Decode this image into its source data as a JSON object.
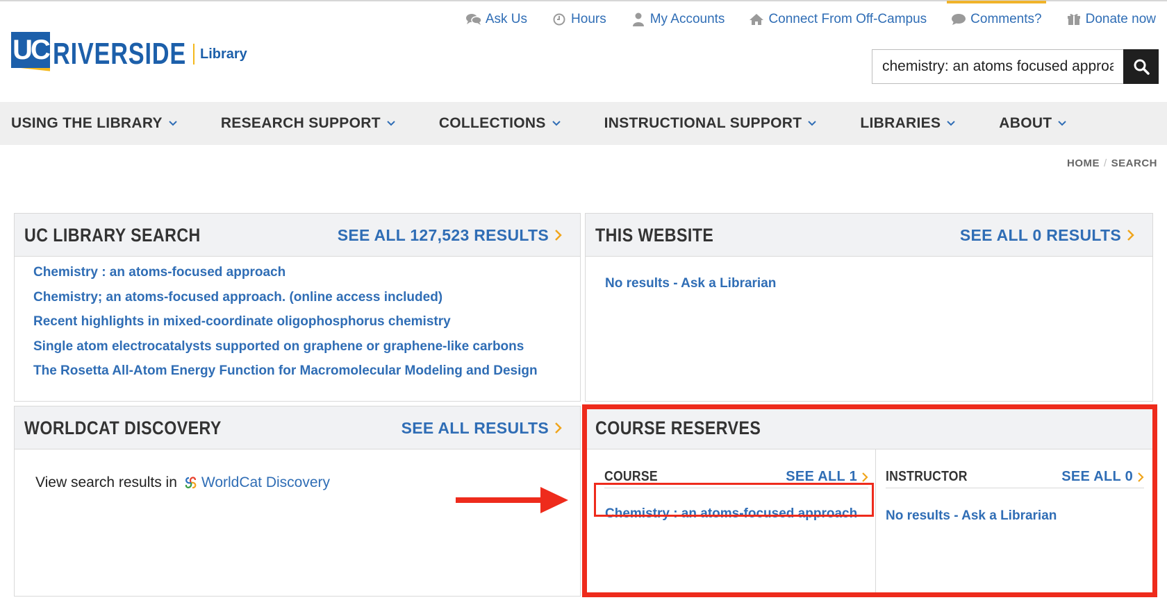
{
  "utility_nav": [
    {
      "label": "Ask Us",
      "icon": "chat-icon"
    },
    {
      "label": "Hours",
      "icon": "clock-icon"
    },
    {
      "label": "My Accounts",
      "icon": "user-icon"
    },
    {
      "label": "Connect From Off-Campus",
      "icon": "home-icon"
    },
    {
      "label": "Comments?",
      "icon": "comment-icon",
      "active": true
    },
    {
      "label": "Donate now",
      "icon": "gift-icon"
    }
  ],
  "logo": {
    "uc": "UC",
    "name": "RIVERSIDE",
    "sub": "Library"
  },
  "search": {
    "value": "chemistry: an atoms focused approa"
  },
  "main_nav": [
    {
      "label": "USING THE LIBRARY"
    },
    {
      "label": "RESEARCH SUPPORT"
    },
    {
      "label": "COLLECTIONS"
    },
    {
      "label": "INSTRUCTIONAL SUPPORT"
    },
    {
      "label": "LIBRARIES"
    },
    {
      "label": "ABOUT"
    }
  ],
  "breadcrumb": {
    "home": "HOME",
    "separator": "/",
    "current": "SEARCH"
  },
  "panels": {
    "uc_library_search": {
      "title": "UC LIBRARY SEARCH",
      "see_all": "SEE ALL 127,523 RESULTS",
      "results": [
        "Chemistry : an atoms-focused approach",
        "Chemistry; an atoms-focused approach. (online access included)",
        "Recent highlights in mixed-coordinate oligophosphorus chemistry",
        "Single atom electrocatalysts supported on graphene or graphene-like carbons",
        "The Rosetta All-Atom Energy Function for Macromolecular Modeling and Design"
      ]
    },
    "this_website": {
      "title": "THIS WEBSITE",
      "see_all": "SEE ALL 0 RESULTS",
      "no_results": "No results - Ask a Librarian"
    },
    "worldcat": {
      "title": "WORLDCAT DISCOVERY",
      "see_all": "SEE ALL RESULTS",
      "text": "View search results in",
      "link": "WorldCat Discovery"
    },
    "course_reserves": {
      "title": "COURSE RESERVES",
      "course": {
        "header": "COURSE",
        "see_all": "SEE ALL 1",
        "result": "Chemistry : an atoms-focused approach"
      },
      "instructor": {
        "header": "INSTRUCTOR",
        "see_all": "SEE ALL 0",
        "result": "No results - Ask a Librarian"
      }
    }
  },
  "colors": {
    "link": "#2f6db5",
    "brand_blue": "#1c5faa",
    "brand_gold": "#f4b81c",
    "chevron": "#f0a51b",
    "annotation": "#ee2b1c",
    "nav_bg": "#efefef",
    "panel_header_bg": "#f1f2f4"
  }
}
